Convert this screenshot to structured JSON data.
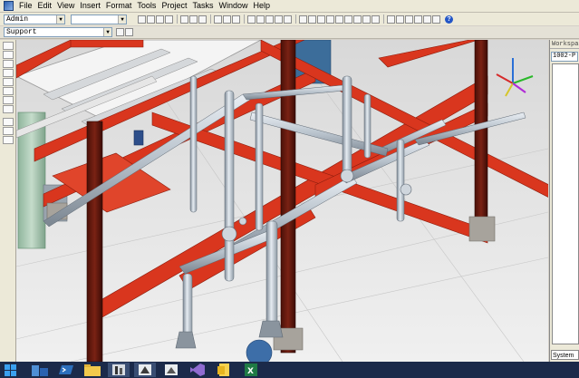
{
  "menu": {
    "items": [
      "File",
      "Edit",
      "View",
      "Insert",
      "Format",
      "Tools",
      "Project",
      "Tasks",
      "Window",
      "Help"
    ]
  },
  "toolbar": {
    "user_combo": "Admin",
    "blank_combo": "",
    "filter_combo": "Support"
  },
  "workspace": {
    "title": "Workspa",
    "project_combo": "1002-P",
    "bottom_tab": "System"
  },
  "taskbar": {
    "icons": [
      "windows-start-icon",
      "file-explorer-icon",
      "powershell-icon",
      "folder-icon",
      "plant-app-icon",
      "model-app-icon",
      "model-app-icon-2",
      "visual-studio-icon",
      "notes-icon",
      "excel-icon"
    ]
  },
  "colors": {
    "steel_red": "#d9361e",
    "column_dark": "#6b1a10",
    "pipe_silver": "#b8c2cc",
    "background": "#e8e8e8"
  }
}
